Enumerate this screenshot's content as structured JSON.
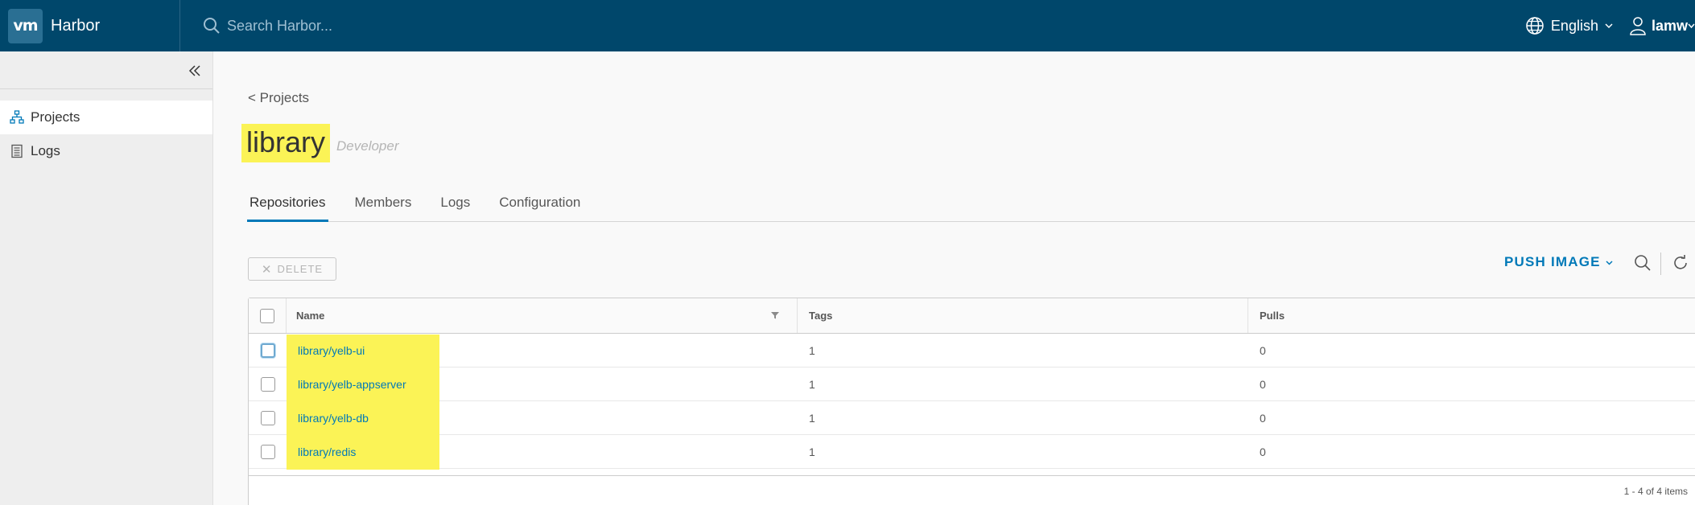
{
  "header": {
    "logo_text": "vm",
    "app_name": "Harbor",
    "search_placeholder": "Search Harbor...",
    "language": "English",
    "username": "lamw",
    "bg_color": "#00476b"
  },
  "sidebar": {
    "items": [
      {
        "label": "Projects",
        "icon": "projects-tree-icon",
        "active": true
      },
      {
        "label": "Logs",
        "icon": "logs-document-icon",
        "active": false
      }
    ]
  },
  "main": {
    "breadcrumb": "< Projects",
    "title": "library",
    "role": "Developer",
    "tabs": [
      {
        "label": "Repositories",
        "active": true
      },
      {
        "label": "Members",
        "active": false
      },
      {
        "label": "Logs",
        "active": false
      },
      {
        "label": "Configuration",
        "active": false
      }
    ],
    "delete_label": "DELETE",
    "push_image_label": "PUSH IMAGE",
    "accent_color": "#0079b8",
    "highlight_color": "#fbf356"
  },
  "table": {
    "columns": [
      "Name",
      "Tags",
      "Pulls"
    ],
    "rows": [
      {
        "name": "library/yelb-ui",
        "tags": "1",
        "pulls": "0"
      },
      {
        "name": "library/yelb-appserver",
        "tags": "1",
        "pulls": "0"
      },
      {
        "name": "library/yelb-db",
        "tags": "1",
        "pulls": "0"
      },
      {
        "name": "library/redis",
        "tags": "1",
        "pulls": "0"
      }
    ],
    "footer": "1 - 4 of 4 items"
  }
}
